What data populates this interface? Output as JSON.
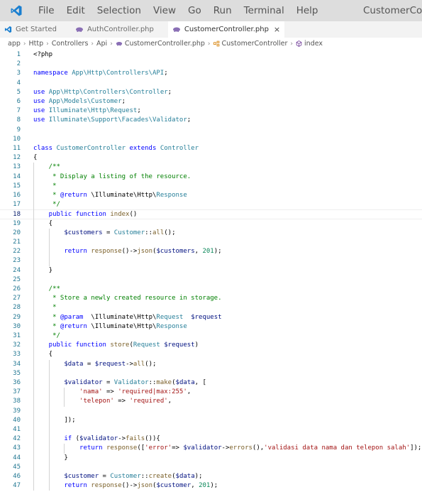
{
  "titlebar": {
    "menu": [
      "File",
      "Edit",
      "Selection",
      "View",
      "Go",
      "Run",
      "Terminal",
      "Help"
    ],
    "title": "CustomerContro"
  },
  "tabs": [
    {
      "label": "Get Started",
      "icon": "vscode-icon",
      "active": false
    },
    {
      "label": "AuthController.php",
      "icon": "php-elephant-icon",
      "active": false
    },
    {
      "label": "CustomerController.php",
      "icon": "php-elephant-icon",
      "active": true,
      "close": "×"
    }
  ],
  "breadcrumb": [
    "app",
    "Http",
    "Controllers",
    "Api",
    "CustomerController.php",
    "CustomerController",
    "index"
  ],
  "editor": {
    "current_line": 18,
    "lines": [
      [
        [
          "op",
          "<?php"
        ]
      ],
      [],
      [
        [
          "kw",
          "namespace "
        ],
        [
          "ns",
          "App\\Http\\Controllers\\API"
        ],
        [
          "op",
          ";"
        ]
      ],
      [],
      [
        [
          "kw",
          "use "
        ],
        [
          "ns",
          "App\\Http\\Controllers\\"
        ],
        [
          "cls",
          "Controller"
        ],
        [
          "op",
          ";"
        ]
      ],
      [
        [
          "kw",
          "use "
        ],
        [
          "ns",
          "App\\Models\\"
        ],
        [
          "cls",
          "Customer"
        ],
        [
          "op",
          ";"
        ]
      ],
      [
        [
          "kw",
          "use "
        ],
        [
          "ns",
          "Illuminate\\Http\\"
        ],
        [
          "cls",
          "Request"
        ],
        [
          "op",
          ";"
        ]
      ],
      [
        [
          "kw",
          "use "
        ],
        [
          "ns",
          "Illuminate\\Support\\Facades\\"
        ],
        [
          "cls",
          "Validator"
        ],
        [
          "op",
          ";"
        ]
      ],
      [],
      [],
      [
        [
          "kw",
          "class "
        ],
        [
          "cls",
          "CustomerController "
        ],
        [
          "kw",
          "extends "
        ],
        [
          "cls",
          "Controller"
        ]
      ],
      [
        [
          "op",
          "{"
        ]
      ],
      [
        [
          "com",
          "    /**"
        ]
      ],
      [
        [
          "com",
          "     * Display a listing of the resource."
        ]
      ],
      [
        [
          "com",
          "     *"
        ]
      ],
      [
        [
          "com",
          "     * "
        ],
        [
          "kw",
          "@return "
        ],
        [
          "op",
          "\\Illuminate\\Http\\"
        ],
        [
          "cls",
          "Response"
        ]
      ],
      [
        [
          "com",
          "     */"
        ]
      ],
      [
        [
          "kw",
          "    public function "
        ],
        [
          "fn",
          "index"
        ],
        [
          "op",
          "()"
        ]
      ],
      [
        [
          "op",
          "    {"
        ]
      ],
      [
        [
          "var",
          "        $customers "
        ],
        [
          "op",
          "= "
        ],
        [
          "cls",
          "Customer"
        ],
        [
          "op",
          "::"
        ],
        [
          "fn",
          "all"
        ],
        [
          "op",
          "();"
        ]
      ],
      [],
      [
        [
          "kw",
          "        return "
        ],
        [
          "fn",
          "response"
        ],
        [
          "op",
          "()->"
        ],
        [
          "fn",
          "json"
        ],
        [
          "op",
          "("
        ],
        [
          "var",
          "$customers"
        ],
        [
          "op",
          ", "
        ],
        [
          "num",
          "201"
        ],
        [
          "op",
          ");"
        ]
      ],
      [],
      [
        [
          "op",
          "    }"
        ]
      ],
      [],
      [
        [
          "com",
          "    /**"
        ]
      ],
      [
        [
          "com",
          "     * Store a newly created resource in storage."
        ]
      ],
      [
        [
          "com",
          "     *"
        ]
      ],
      [
        [
          "com",
          "     * "
        ],
        [
          "kw",
          "@param  "
        ],
        [
          "op",
          "\\Illuminate\\Http\\"
        ],
        [
          "cls",
          "Request  "
        ],
        [
          "var",
          "$request"
        ]
      ],
      [
        [
          "com",
          "     * "
        ],
        [
          "kw",
          "@return "
        ],
        [
          "op",
          "\\Illuminate\\Http\\"
        ],
        [
          "cls",
          "Response"
        ]
      ],
      [
        [
          "com",
          "     */"
        ]
      ],
      [
        [
          "kw",
          "    public function "
        ],
        [
          "fn",
          "store"
        ],
        [
          "op",
          "("
        ],
        [
          "cls",
          "Request "
        ],
        [
          "var",
          "$request"
        ],
        [
          "op",
          ")"
        ]
      ],
      [
        [
          "op",
          "    {"
        ]
      ],
      [
        [
          "var",
          "        $data "
        ],
        [
          "op",
          "= "
        ],
        [
          "var",
          "$request"
        ],
        [
          "op",
          "->"
        ],
        [
          "fn",
          "all"
        ],
        [
          "op",
          "();"
        ]
      ],
      [],
      [
        [
          "var",
          "        $validator "
        ],
        [
          "op",
          "= "
        ],
        [
          "cls",
          "Validator"
        ],
        [
          "op",
          "::"
        ],
        [
          "fn",
          "make"
        ],
        [
          "op",
          "("
        ],
        [
          "var",
          "$data"
        ],
        [
          "op",
          ", ["
        ]
      ],
      [
        [
          "str",
          "            'nama' "
        ],
        [
          "op",
          "=> "
        ],
        [
          "str",
          "'required|max:255'"
        ],
        [
          "op",
          ","
        ]
      ],
      [
        [
          "str",
          "            'telepon' "
        ],
        [
          "op",
          "=> "
        ],
        [
          "str",
          "'required'"
        ],
        [
          "op",
          ","
        ]
      ],
      [],
      [
        [
          "op",
          "        ]);"
        ]
      ],
      [],
      [
        [
          "kw",
          "        if "
        ],
        [
          "op",
          "("
        ],
        [
          "var",
          "$validator"
        ],
        [
          "op",
          "->"
        ],
        [
          "fn",
          "fails"
        ],
        [
          "op",
          "()){"
        ]
      ],
      [
        [
          "kw",
          "            return "
        ],
        [
          "fn",
          "response"
        ],
        [
          "op",
          "(["
        ],
        [
          "str",
          "'error'"
        ],
        [
          "op",
          "=> "
        ],
        [
          "var",
          "$validator"
        ],
        [
          "op",
          "->"
        ],
        [
          "fn",
          "errors"
        ],
        [
          "op",
          "(),"
        ],
        [
          "str",
          "'validasi data nama dan telepon salah'"
        ],
        [
          "op",
          "]);"
        ]
      ],
      [
        [
          "op",
          "        }"
        ]
      ],
      [],
      [
        [
          "var",
          "        $customer "
        ],
        [
          "op",
          "= "
        ],
        [
          "cls",
          "Customer"
        ],
        [
          "op",
          "::"
        ],
        [
          "fn",
          "create"
        ],
        [
          "op",
          "("
        ],
        [
          "var",
          "$data"
        ],
        [
          "op",
          ");"
        ]
      ],
      [
        [
          "kw",
          "        return "
        ],
        [
          "fn",
          "response"
        ],
        [
          "op",
          "()->"
        ],
        [
          "fn",
          "json"
        ],
        [
          "op",
          "("
        ],
        [
          "var",
          "$customer"
        ],
        [
          "op",
          ", "
        ],
        [
          "num",
          "201"
        ],
        [
          "op",
          ");"
        ]
      ]
    ]
  }
}
